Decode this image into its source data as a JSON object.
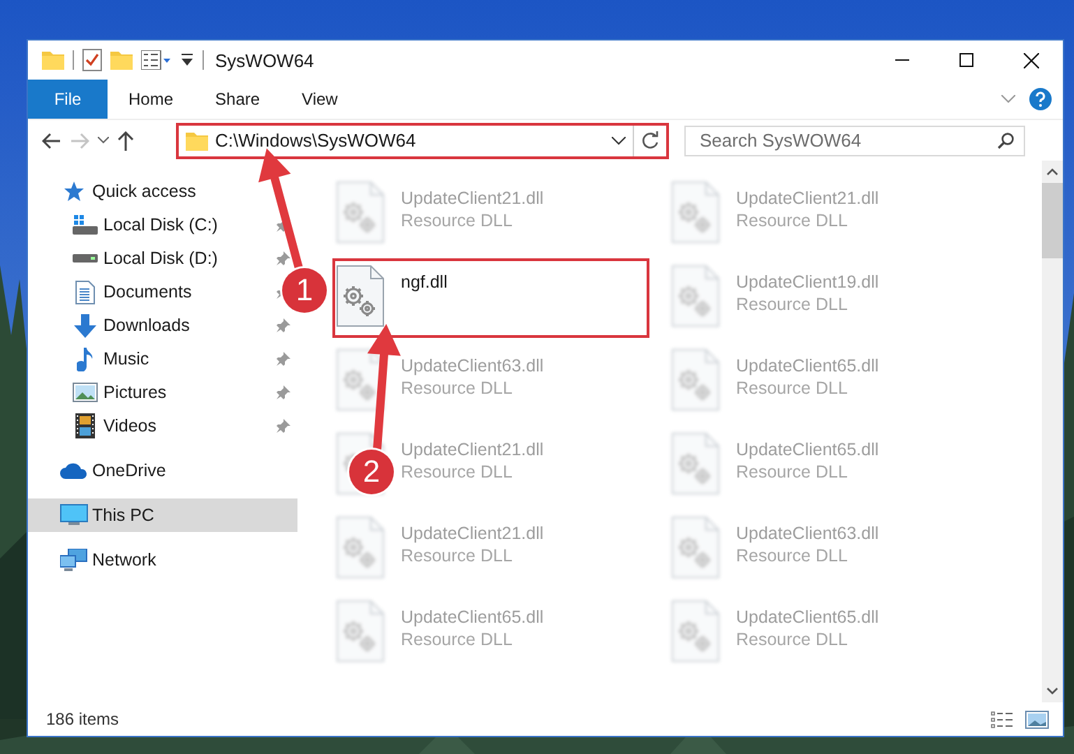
{
  "window": {
    "title": "SysWOW64"
  },
  "ribbon": {
    "file_tab": "File",
    "tabs": [
      "Home",
      "Share",
      "View"
    ]
  },
  "address": {
    "path": "C:\\Windows\\SysWOW64",
    "highlighted": true
  },
  "search": {
    "placeholder": "Search SysWOW64"
  },
  "sidebar": {
    "items": [
      {
        "label": "Quick access",
        "selected": false,
        "children": [
          {
            "label": "Local Disk (C:)",
            "pinned": true
          },
          {
            "label": "Local Disk (D:)",
            "pinned": true
          },
          {
            "label": "Documents",
            "pinned": true
          },
          {
            "label": "Downloads",
            "pinned": true
          },
          {
            "label": "Music",
            "pinned": true
          },
          {
            "label": "Pictures",
            "pinned": true
          },
          {
            "label": "Videos",
            "pinned": true
          }
        ]
      },
      {
        "label": "OneDrive",
        "selected": false
      },
      {
        "label": "This PC",
        "selected": true
      },
      {
        "label": "Network",
        "selected": false
      }
    ]
  },
  "files": [
    {
      "name": "UpdateClient21.dll",
      "type": "Resource DLL",
      "blurred": true,
      "highlighted": false
    },
    {
      "name": "UpdateClient21.dll",
      "type": "Resource DLL",
      "blurred": true,
      "highlighted": false
    },
    {
      "name": "ngf.dll",
      "blurred": false,
      "highlighted": true
    },
    {
      "name": "UpdateClient19.dll",
      "type": "Resource DLL",
      "blurred": true,
      "highlighted": false
    },
    {
      "name": "UpdateClient63.dll",
      "type": "Resource DLL",
      "blurred": true,
      "highlighted": false
    },
    {
      "name": "UpdateClient65.dll",
      "type": "Resource DLL",
      "blurred": true,
      "highlighted": false
    },
    {
      "name": "UpdateClient21.dll",
      "type": "Resource DLL",
      "blurred": true,
      "highlighted": false
    },
    {
      "name": "UpdateClient65.dll",
      "type": "Resource DLL",
      "blurred": true,
      "highlighted": false
    },
    {
      "name": "UpdateClient21.dll",
      "type": "Resource DLL",
      "blurred": true,
      "highlighted": false
    },
    {
      "name": "UpdateClient63.dll",
      "type": "Resource DLL",
      "blurred": true,
      "highlighted": false
    },
    {
      "name": "UpdateClient65.dll",
      "type": "Resource DLL",
      "blurred": true,
      "highlighted": false
    },
    {
      "name": "UpdateClient65.dll",
      "type": "Resource DLL",
      "blurred": true,
      "highlighted": false
    }
  ],
  "annotations": [
    {
      "number": "1"
    },
    {
      "number": "2"
    }
  ],
  "status_bar": {
    "item_count": "186 items"
  }
}
